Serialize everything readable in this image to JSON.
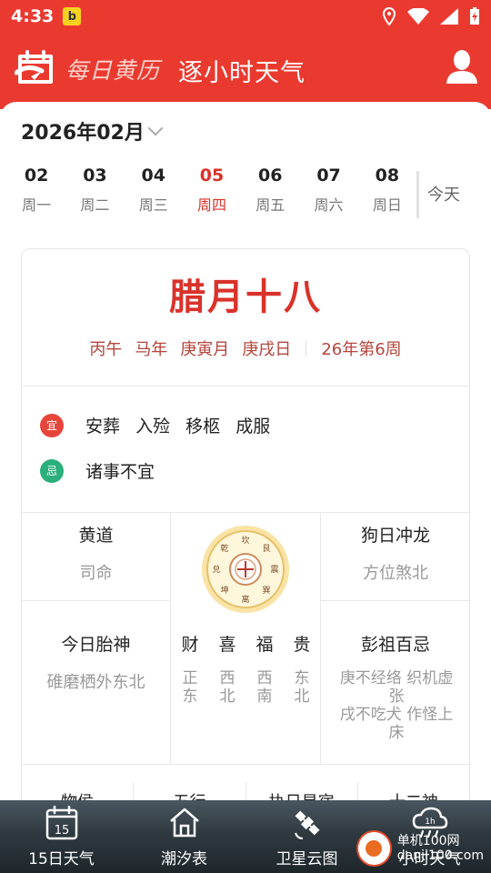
{
  "status_bar": {
    "time": "4:33",
    "app_badge": "b"
  },
  "header": {
    "app_title": "每日黄历",
    "sub_title": "逐小时天气"
  },
  "calendar": {
    "month_label": "2026年02月",
    "days": [
      {
        "num": "02",
        "weekday": "周一",
        "active": false
      },
      {
        "num": "03",
        "weekday": "周二",
        "active": false
      },
      {
        "num": "04",
        "weekday": "周三",
        "active": false
      },
      {
        "num": "05",
        "weekday": "周四",
        "active": true
      },
      {
        "num": "06",
        "weekday": "周五",
        "active": false
      },
      {
        "num": "07",
        "weekday": "周六",
        "active": false
      },
      {
        "num": "08",
        "weekday": "周日",
        "active": false
      }
    ],
    "today_label": "今天"
  },
  "almanac": {
    "lunar_date": "腊月十八",
    "ganzhi": [
      "丙午",
      "马年",
      "庚寅月",
      "庚戌日"
    ],
    "week_of_year": "26年第6周",
    "yi_badge": "宜",
    "yi_items": [
      "安葬",
      "入殓",
      "移柩",
      "成服"
    ],
    "ji_badge": "忌",
    "ji_items": [
      "诸事不宜"
    ],
    "huangdao": {
      "title": "黄道",
      "value": "司命"
    },
    "chong": {
      "title": "狗日冲龙",
      "value": "方位煞北"
    },
    "taishen": {
      "title": "今日胎神",
      "value": "碓磨栖外东北"
    },
    "gods": [
      {
        "name": "财",
        "dir1": "正",
        "dir2": "东"
      },
      {
        "name": "喜",
        "dir1": "西",
        "dir2": "北"
      },
      {
        "name": "福",
        "dir1": "西",
        "dir2": "南"
      },
      {
        "name": "贵",
        "dir1": "东",
        "dir2": "北"
      }
    ],
    "pengzu": {
      "title": "彭祖百忌",
      "line1_a": "庚不经络 织机虚",
      "line1_b": "张",
      "line2_a": "戌不吃犬 作怪上",
      "line2_b": "床"
    },
    "compass_chars": [
      "坎",
      "艮",
      "震",
      "巽",
      "离",
      "坤",
      "兑",
      "乾"
    ],
    "bottom_titles": [
      "物侯",
      "五行",
      "执日星宿",
      "十二神"
    ]
  },
  "nav": {
    "items": [
      {
        "label": "15日天气",
        "icon": "calendar-icon",
        "icon_text": "15"
      },
      {
        "label": "潮汐表",
        "icon": "house-icon"
      },
      {
        "label": "卫星云图",
        "icon": "satellite-icon"
      },
      {
        "label": "小时天气",
        "icon": "rain-cloud-icon",
        "icon_text": "1h"
      }
    ]
  },
  "watermark": {
    "line1": "单机100网",
    "line2": "danji100.com"
  },
  "colors": {
    "brand_red": "#ea3a30",
    "lunar_red": "#d9322a",
    "yi_red": "#e6453b",
    "ji_green": "#2bb07b"
  }
}
